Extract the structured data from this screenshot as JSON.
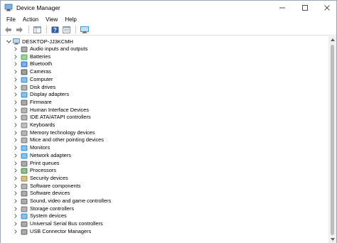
{
  "window": {
    "title": "Device Manager"
  },
  "menu": [
    "File",
    "Action",
    "View",
    "Help"
  ],
  "toolbar_icons": [
    "back-arrow-icon",
    "forward-arrow-icon",
    "show-hide-icon",
    "help-icon",
    "properties-icon",
    "scan-monitor-icon"
  ],
  "tree": {
    "root": "DESKTOP-JJ3KCMH",
    "items": [
      {
        "label": "Audio inputs and outputs",
        "icon": "audio-icon",
        "color": "#6a6a6a"
      },
      {
        "label": "Batteries",
        "icon": "battery-icon",
        "color": "#4caf50"
      },
      {
        "label": "Bluetooth",
        "icon": "bluetooth-icon",
        "color": "#1e6fd9"
      },
      {
        "label": "Cameras",
        "icon": "camera-icon",
        "color": "#555555"
      },
      {
        "label": "Computer",
        "icon": "computer-icon",
        "color": "#2b8fd6"
      },
      {
        "label": "Disk drives",
        "icon": "disk-icon",
        "color": "#777777"
      },
      {
        "label": "Display adapters",
        "icon": "display-adapter-icon",
        "color": "#2b8fd6"
      },
      {
        "label": "Firmware",
        "icon": "firmware-icon",
        "color": "#666666"
      },
      {
        "label": "Human Interface Devices",
        "icon": "hid-icon",
        "color": "#7a7a7a"
      },
      {
        "label": "IDE ATA/ATAPI controllers",
        "icon": "ide-icon",
        "color": "#7a7a7a"
      },
      {
        "label": "Keyboards",
        "icon": "keyboard-icon",
        "color": "#8a8a8a"
      },
      {
        "label": "Memory technology devices",
        "icon": "memory-icon",
        "color": "#7a7a7a"
      },
      {
        "label": "Mice and other pointing devices",
        "icon": "mouse-icon",
        "color": "#7a7a7a"
      },
      {
        "label": "Monitors",
        "icon": "monitor-icon",
        "color": "#2b8fd6"
      },
      {
        "label": "Network adapters",
        "icon": "network-icon",
        "color": "#2b8fd6"
      },
      {
        "label": "Print queues",
        "icon": "printer-icon",
        "color": "#6a6a6a"
      },
      {
        "label": "Processors",
        "icon": "processor-icon",
        "color": "#3c8c3c"
      },
      {
        "label": "Security devices",
        "icon": "security-icon",
        "color": "#b08a2e"
      },
      {
        "label": "Software components",
        "icon": "software-component-icon",
        "color": "#7a7a7a"
      },
      {
        "label": "Software devices",
        "icon": "software-device-icon",
        "color": "#6a6a6a"
      },
      {
        "label": "Sound, video and game controllers",
        "icon": "sound-icon",
        "color": "#6a6a6a"
      },
      {
        "label": "Storage controllers",
        "icon": "storage-icon",
        "color": "#7a7a7a"
      },
      {
        "label": "System devices",
        "icon": "system-icon",
        "color": "#2b8fd6"
      },
      {
        "label": "Universal Serial Bus controllers",
        "icon": "usb-icon",
        "color": "#6a6a6a"
      },
      {
        "label": "USB Connector Managers",
        "icon": "usb-connector-icon",
        "color": "#6a6a6a"
      }
    ]
  }
}
